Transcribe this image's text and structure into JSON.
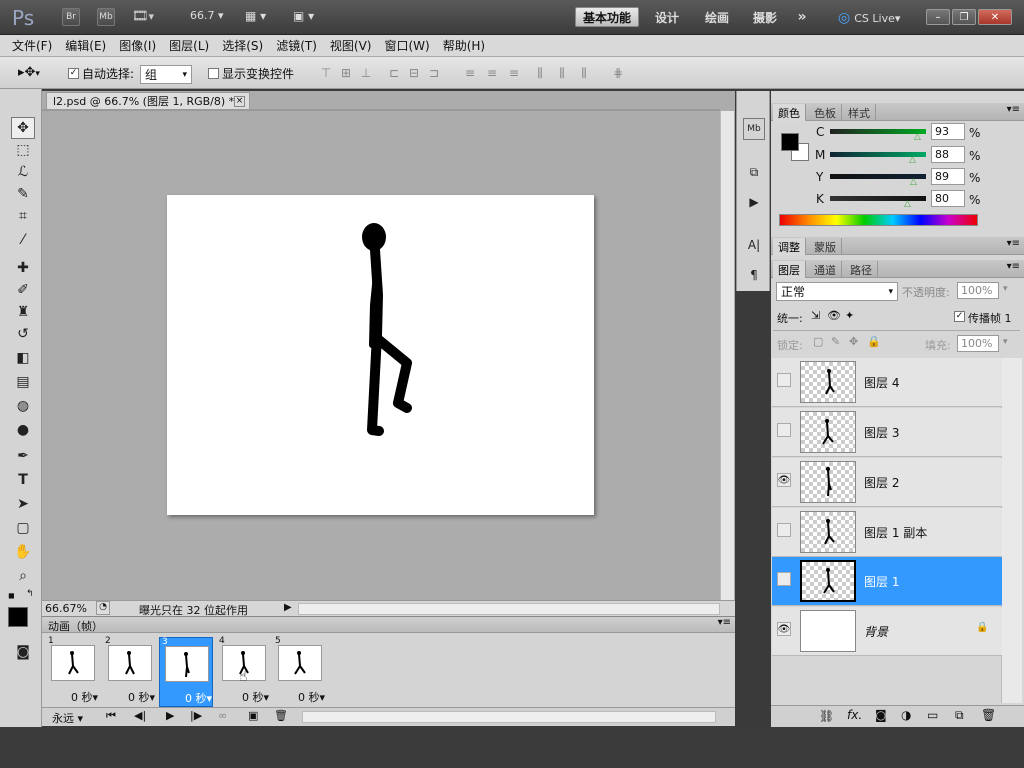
{
  "titlebar": {
    "app_logo": "Ps",
    "bridge_btn": "Br",
    "mini_bridge_btn": "Mb",
    "zoom_value": "66.7",
    "workspaces": [
      "基本功能",
      "设计",
      "绘画",
      "摄影"
    ],
    "more_glyph": "»",
    "cs_live": "CS Live",
    "window_buttons": [
      "–",
      "❐",
      "✕"
    ]
  },
  "menu": [
    "文件(F)",
    "编辑(E)",
    "图像(I)",
    "图层(L)",
    "选择(S)",
    "滤镜(T)",
    "视图(V)",
    "窗口(W)",
    "帮助(H)"
  ],
  "options": {
    "auto_select_label": "自动选择:",
    "auto_select_checked": "✓",
    "auto_select_value": "组",
    "show_transform_label": "显示变换控件"
  },
  "document": {
    "tab_title": "l2.psd @ 66.7% (图层 1, RGB/8) *",
    "tab_close": "×",
    "zoom": "66.67%",
    "status_text": "曝光只在 32 位起作用"
  },
  "animation": {
    "title": "动画（帧）",
    "loop": "永远",
    "frames": [
      {
        "num": "1",
        "duration": "0 秒▾"
      },
      {
        "num": "2",
        "duration": "0 秒▾"
      },
      {
        "num": "3",
        "duration": "0 秒▾"
      },
      {
        "num": "4",
        "duration": "0 秒▾"
      },
      {
        "num": "5",
        "duration": "0 秒▾"
      }
    ]
  },
  "color_panel": {
    "tabs": [
      "颜色",
      "色板",
      "样式"
    ],
    "channels": [
      {
        "label": "C",
        "value": "93",
        "unit": "%"
      },
      {
        "label": "M",
        "value": "88",
        "unit": "%"
      },
      {
        "label": "Y",
        "value": "89",
        "unit": "%"
      },
      {
        "label": "K",
        "value": "80",
        "unit": "%"
      }
    ]
  },
  "adjust_panel": {
    "tabs": [
      "调整",
      "蒙版"
    ]
  },
  "layers_panel": {
    "tabs": [
      "图层",
      "通道",
      "路径"
    ],
    "blend_mode": "正常",
    "opacity_label": "不透明度:",
    "opacity_value": "100%",
    "unify_label": "统一:",
    "propagate_label": "传播帧 1",
    "propagate_checked": "✓",
    "lock_label": "锁定:",
    "fill_label": "填充:",
    "fill_value": "100%",
    "layers": [
      {
        "name": "图层 4",
        "visible": ""
      },
      {
        "name": "图层 3",
        "visible": ""
      },
      {
        "name": "图层 2",
        "visible": "👁"
      },
      {
        "name": "图层 1 副本",
        "visible": ""
      },
      {
        "name": "图层 1",
        "visible": ""
      },
      {
        "name": "背景",
        "visible": "👁",
        "lock": "🔒"
      }
    ]
  },
  "colors": {
    "accent": "#3399ff",
    "foreground": "#000000",
    "background": "#ffffff"
  }
}
